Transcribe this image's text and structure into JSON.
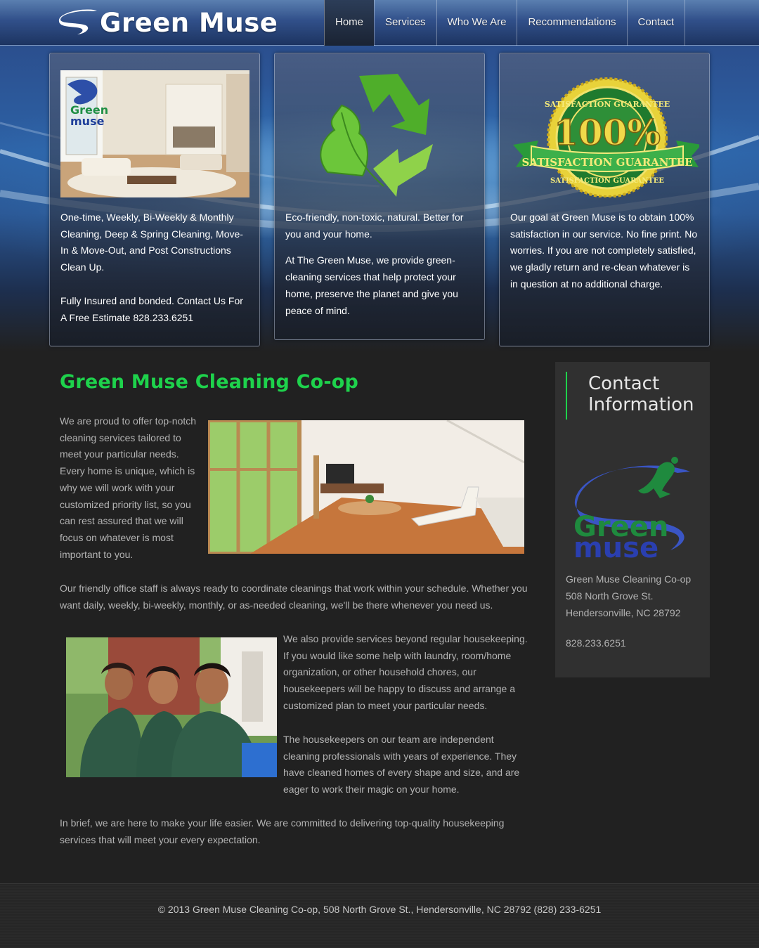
{
  "brand": {
    "name": "Green Muse",
    "logo_word1": "Green",
    "logo_word2": "muse"
  },
  "nav": {
    "items": [
      {
        "label": "Home",
        "active": true
      },
      {
        "label": "Services",
        "active": false
      },
      {
        "label": "Who We Are",
        "active": false
      },
      {
        "label": "Recommendations",
        "active": false
      },
      {
        "label": "Contact",
        "active": false
      }
    ]
  },
  "cards": [
    {
      "paragraphs": [
        "One-time, Weekly, Bi-Weekly & Monthly Cleaning, Deep & Spring Cleaning, Move-In & Move-Out, and Post Constructions Clean Up.",
        "Fully Insured and bonded.  Contact Us For A Free Estimate 828.233.6251"
      ]
    },
    {
      "paragraphs": [
        "Eco-friendly, non-toxic, natural.  Better for you and your home.",
        "At The Green Muse, we provide green-cleaning services that help protect your home, preserve the planet and give you peace of mind."
      ]
    },
    {
      "badge_top": "SATISFACTION GUARANTEE",
      "badge_big": "100%",
      "badge_ribbon": "SATISFACTION GUARANTEE",
      "badge_bottom": "SATISFACTION GUARANTEE",
      "paragraphs": [
        "Our goal at Green Muse is to obtain 100% satisfaction in our service. No fine print. No worries.  If you are not completely satisfied, we gladly return and re-clean whatever is in question at no additional charge."
      ]
    }
  ],
  "main": {
    "title": "Green Muse Cleaning Co-op",
    "intro": "We are proud to offer top-notch cleaning services tailored to meet your particular needs. Every home is unique, which is why we will work with your customized priority list, so you can rest assured that we will focus on whatever is most important to you.",
    "office": "Our friendly office staff is always ready to coordinate cleanings that work within your schedule. Whether you want daily, weekly, bi-weekly, monthly, or as-needed cleaning, we'll be there whenever you need us.",
    "beyond": "We also provide services beyond regular housekeeping. If you would like some help with laundry, room/home organization, or other household chores, our housekeepers will be happy to discuss and arrange a customized plan to meet your particular needs.",
    "team": "The housekeepers on our team are independent cleaning professionals with years of experience. They have cleaned homes of every shape and size, and are eager to work their magic on your home.",
    "brief": "In brief, we are here to make your life easier. We are committed to delivering top-quality housekeeping services that will meet your every expectation."
  },
  "sidebar": {
    "title_line1": "Contact",
    "title_line2": "Information",
    "org": "Green Muse Cleaning Co-op",
    "street": "508 North Grove St.",
    "city": "Hendersonville, NC 28792",
    "phone": "828.233.6251"
  },
  "footer": {
    "text": "© 2013 Green Muse Cleaning Co-op, 508 North Grove St., Hendersonville, NC 28792 (828) 233-6251"
  },
  "colors": {
    "accent_green": "#1ed24c",
    "nav_blue": "#31508a",
    "background": "#212121",
    "panel": "#303030"
  }
}
